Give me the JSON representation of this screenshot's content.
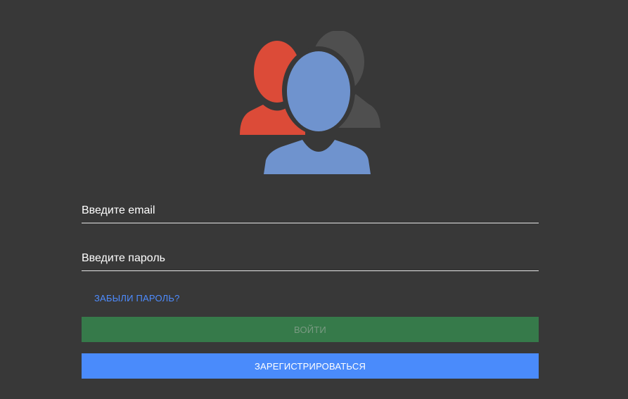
{
  "logo": {
    "icon": "users-group-icon",
    "colors": {
      "back_person": "#555555",
      "left_person": "#dc4b38",
      "front_person": "#6f93ce"
    }
  },
  "form": {
    "email_placeholder": "Введите email",
    "password_placeholder": "Введите пароль",
    "forgot_password": "ЗАБЫЛИ ПАРОЛЬ?",
    "login_button": "ВОЙТИ",
    "register_button": "ЗАРЕГИСТРИРОВАТЬСЯ"
  },
  "colors": {
    "background": "#383838",
    "login": "#367a4a",
    "register": "#4a8bfb",
    "link": "#4e8cff"
  }
}
